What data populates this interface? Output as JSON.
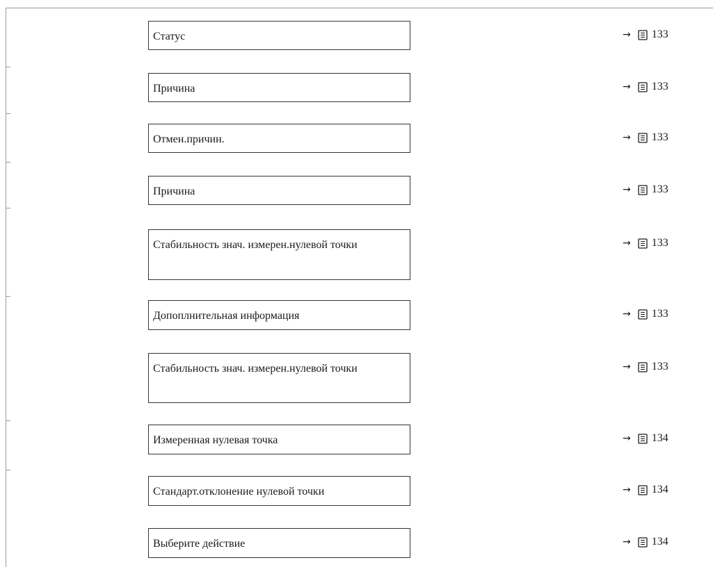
{
  "rows": [
    {
      "label": "Статус",
      "page": "133"
    },
    {
      "label": "Причина",
      "page": "133"
    },
    {
      "label": "Отмен.причин.",
      "page": "133"
    },
    {
      "label": "Причина",
      "page": "133"
    },
    {
      "label": "Стабильность знач. измерен.нулевой точки",
      "page": "133"
    },
    {
      "label": "Допоплнительная информация",
      "page": "133"
    },
    {
      "label": "Стабильность знач. измерен.нулевой точки",
      "page": "133"
    },
    {
      "label": "Измеренная нулевая точка",
      "page": "134"
    },
    {
      "label": "Стандарт.отклонение нулевой точки",
      "page": "134"
    },
    {
      "label": "Выберите действие",
      "page": "134"
    }
  ],
  "ref_arrow": "→",
  "icons": {
    "arrow": "arrow-icon",
    "page_ref": "book-icon"
  }
}
